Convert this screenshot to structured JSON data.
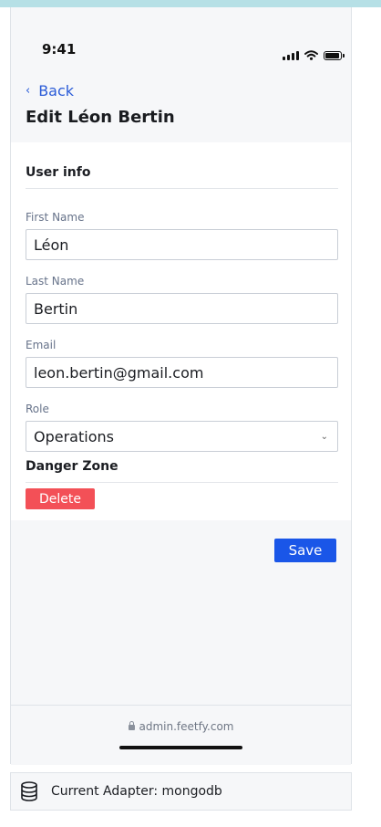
{
  "status_bar": {
    "time": "9:41"
  },
  "nav": {
    "back_label": "Back",
    "title": "Edit Léon Bertin"
  },
  "user_info": {
    "section_title": "User info",
    "fields": {
      "first_name": {
        "label": "First Name",
        "value": "Léon"
      },
      "last_name": {
        "label": "Last Name",
        "value": "Bertin"
      },
      "email": {
        "label": "Email",
        "value": "leon.bertin@gmail.com"
      },
      "role": {
        "label": "Role",
        "value": "Operations"
      }
    }
  },
  "danger_zone": {
    "title": "Danger Zone",
    "delete_label": "Delete"
  },
  "actions": {
    "save_label": "Save"
  },
  "browser": {
    "url": "admin.feetfy.com"
  },
  "footer": {
    "adapter_text": "Current Adapter: mongodb"
  },
  "colors": {
    "accent": "#1a56e8",
    "link": "#2a5bd7",
    "danger": "#f35057",
    "top_strip": "#b6e0e6"
  },
  "icons": {
    "lock": "lock-icon",
    "database": "database-icon",
    "wifi": "wifi-icon",
    "signal": "signal-icon",
    "battery": "battery-icon"
  }
}
